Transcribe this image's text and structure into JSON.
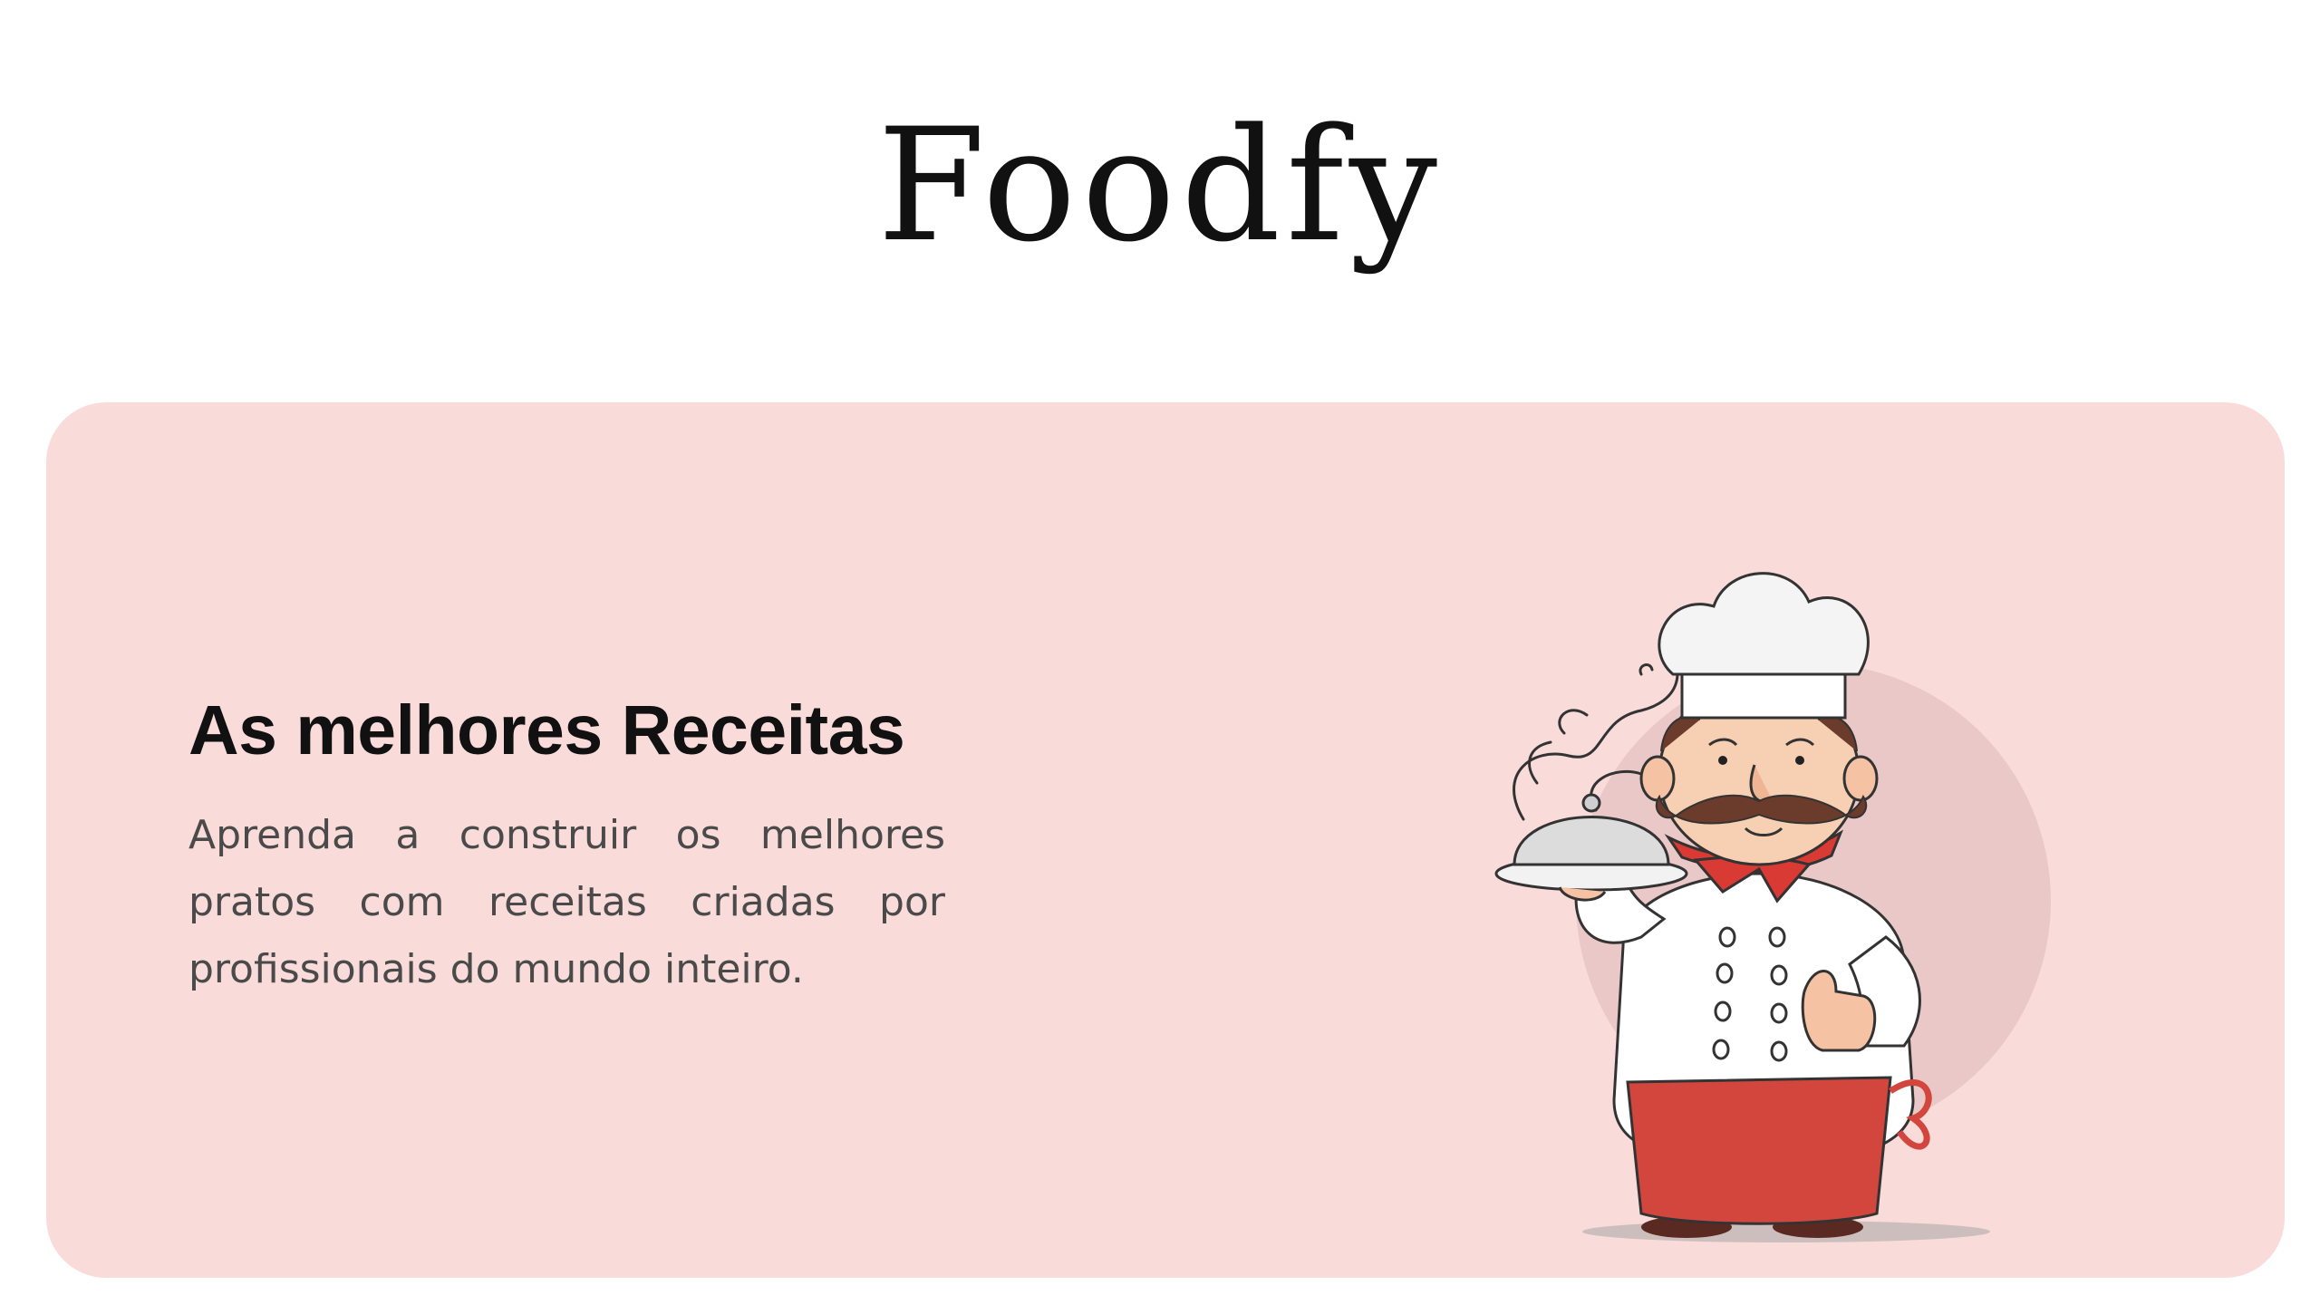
{
  "header": {
    "logo": "Foodfy"
  },
  "hero": {
    "title": "As melhores Receitas",
    "description": "Aprenda a construir os melhores pratos com receitas criadas por profissionais do mundo inteiro.",
    "illustration": "chef-illustration"
  },
  "colors": {
    "hero_background": "#f9dcda",
    "title": "#111111",
    "text": "#4a4a4a",
    "apron": "#d2463e",
    "scarf": "#d93a33"
  }
}
